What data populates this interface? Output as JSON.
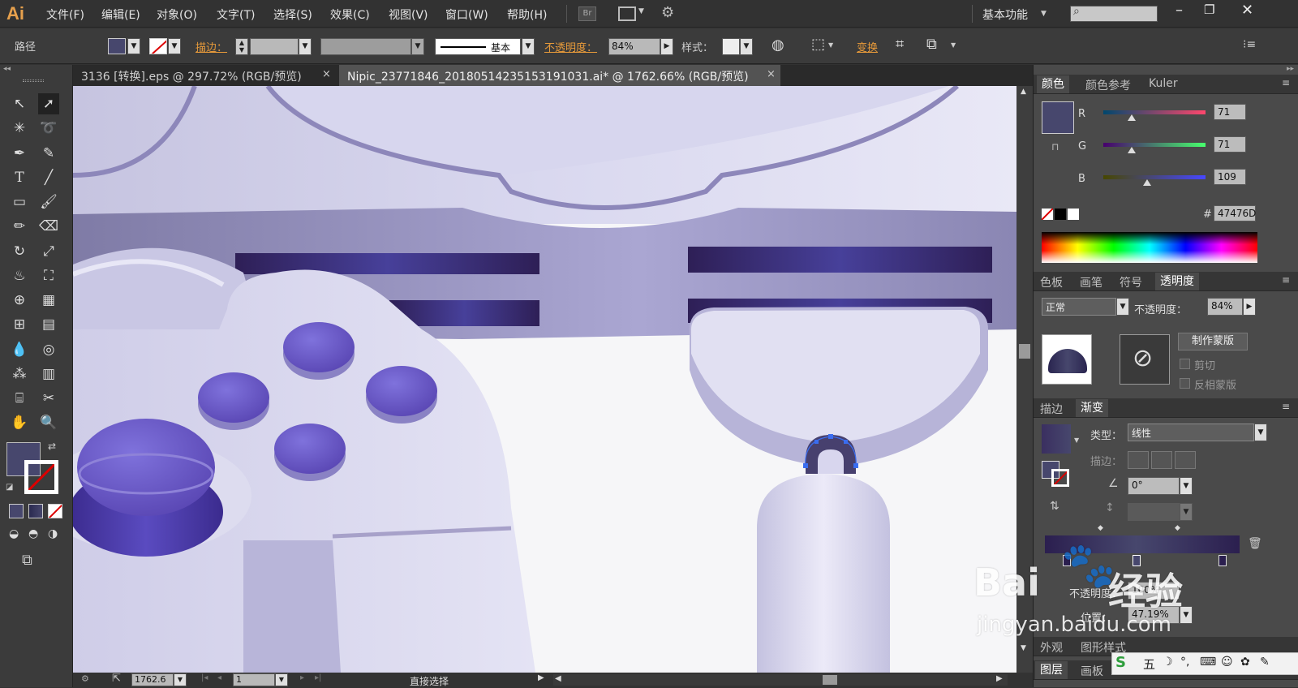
{
  "app": {
    "logo": "Ai",
    "workspace": "基本功能",
    "search_placeholder": ""
  },
  "menu": [
    "文件(F)",
    "编辑(E)",
    "对象(O)",
    "文字(T)",
    "选择(S)",
    "效果(C)",
    "视图(V)",
    "窗口(W)",
    "帮助(H)"
  ],
  "menu_icons": {
    "br": "Br"
  },
  "control": {
    "object_type": "路径",
    "stroke_label": "描边：",
    "brush_style": "基本",
    "opacity_label": "不透明度：",
    "opacity_value": "84%",
    "style_label": "样式：",
    "transform_label": "变换"
  },
  "tabs": [
    {
      "label": "3136 [转换].eps @ 297.72% (RGB/预览)",
      "close": "×"
    },
    {
      "label": "Nipic_23771846_20180514235153191031.ai* @ 1762.66% (RGB/预览)",
      "close": "×"
    }
  ],
  "color_panel": {
    "tabs": [
      "颜色",
      "颜色参考",
      "Kuler"
    ],
    "r_label": "R",
    "g_label": "G",
    "b_label": "B",
    "r": 71,
    "g": 71,
    "b": 109,
    "r_value": "71",
    "g_value": "71",
    "b_value": "109",
    "hash": "#",
    "hex": "47476D",
    "current_color": "#47476D"
  },
  "transparency_panel": {
    "tabs": [
      "色板",
      "画笔",
      "符号",
      "透明度"
    ],
    "blend_mode": "正常",
    "opacity_label": "不透明度：",
    "opacity_value": "84%",
    "make_mask": "制作蒙版",
    "clip": "剪切",
    "invert_mask": "反相蒙版"
  },
  "gradient_panel": {
    "tabs": [
      "描边",
      "渐变"
    ],
    "type_label": "类型：",
    "type_value": "线性",
    "stroke_label": "描边：",
    "angle": "0°",
    "opacity_label": "不透明度：",
    "opacity_value": "100%",
    "location_label": "位置：",
    "location_value": "47.19%"
  },
  "bottom_panels": {
    "row1": [
      "外观",
      "图形样式"
    ],
    "row2": [
      "图层",
      "画板"
    ]
  },
  "status": {
    "zoom": "1762.6",
    "page": "1",
    "tool": "直接选择"
  },
  "ime": {
    "label": "五"
  },
  "watermark": {
    "brand": "Bai",
    "logo_cn": "经验",
    "url": "jingyan.baidu.com"
  },
  "colors": {
    "accent": "#e79a3a",
    "panel": "#4a4a4a",
    "canvas": "#f6f6f8",
    "controller": "#d3d1ea",
    "button_purple": "#6a5ac8",
    "stripe_dark": "#3a2a66"
  }
}
